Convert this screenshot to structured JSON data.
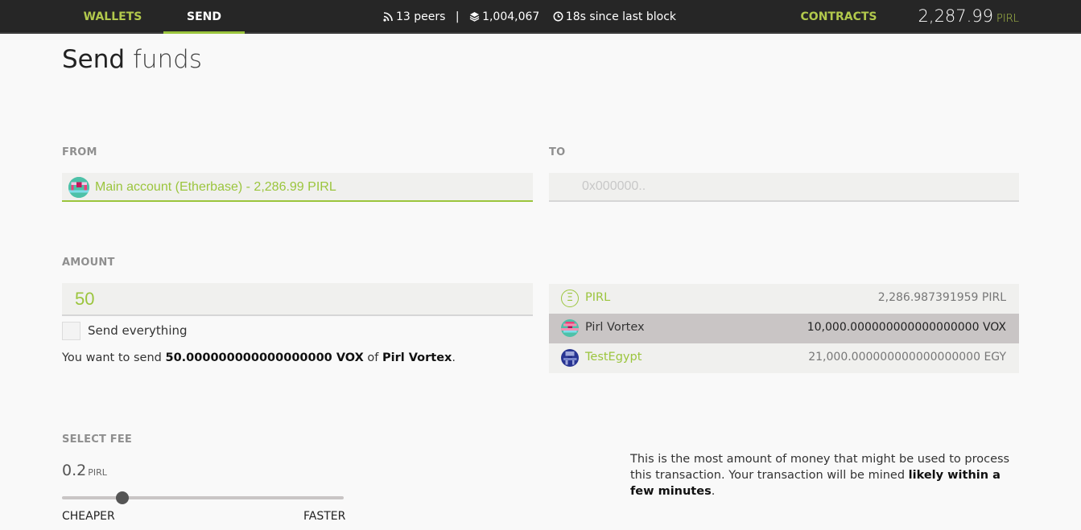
{
  "nav": {
    "wallets": "WALLETS",
    "send": "SEND",
    "contracts": "CONTRACTS"
  },
  "status": {
    "peers": "13 peers",
    "separator": "|",
    "block": "1,004,067",
    "since_block": "18s since last block"
  },
  "balance": {
    "amount": "2,287.99",
    "unit": "PIRL"
  },
  "page": {
    "title_bold": "Send",
    "title_light": "funds"
  },
  "from": {
    "label": "FROM",
    "account": "Main account (Etherbase) - 2,286.99 PIRL"
  },
  "to": {
    "label": "TO",
    "placeholder": "0x000000.."
  },
  "amount": {
    "label": "AMOUNT",
    "value": "50",
    "send_everything": "Send everything",
    "summary_prefix": "You want to send ",
    "summary_amount": "50.000000000000000000 VOX",
    "summary_of": " of ",
    "summary_token": "Pirl Vortex",
    "summary_end": "."
  },
  "tokens": [
    {
      "name": "PIRL",
      "balance": "2,286.987391959 PIRL",
      "icon": "ether-icon",
      "selected": false
    },
    {
      "name": "Pirl Vortex",
      "balance": "10,000.000000000000000000 VOX",
      "icon": "vortex-identicon",
      "selected": true
    },
    {
      "name": "TestEgypt",
      "balance": "21,000.000000000000000000 EGY",
      "icon": "egypt-identicon",
      "selected": false
    }
  ],
  "fee": {
    "label": "SELECT FEE",
    "value": "0.2",
    "unit": "PIRL",
    "cheaper": "CHEAPER",
    "faster": "FASTER",
    "slider_level": 0.2,
    "info_text": "This is the most amount of money that might be used to process this transaction. Your transaction will be mined ",
    "info_bold": "likely within a few minutes",
    "info_end": "."
  },
  "colors": {
    "accent": "#9bc53d",
    "topbar": "#262626",
    "selected_row": "#c9c5c5"
  }
}
